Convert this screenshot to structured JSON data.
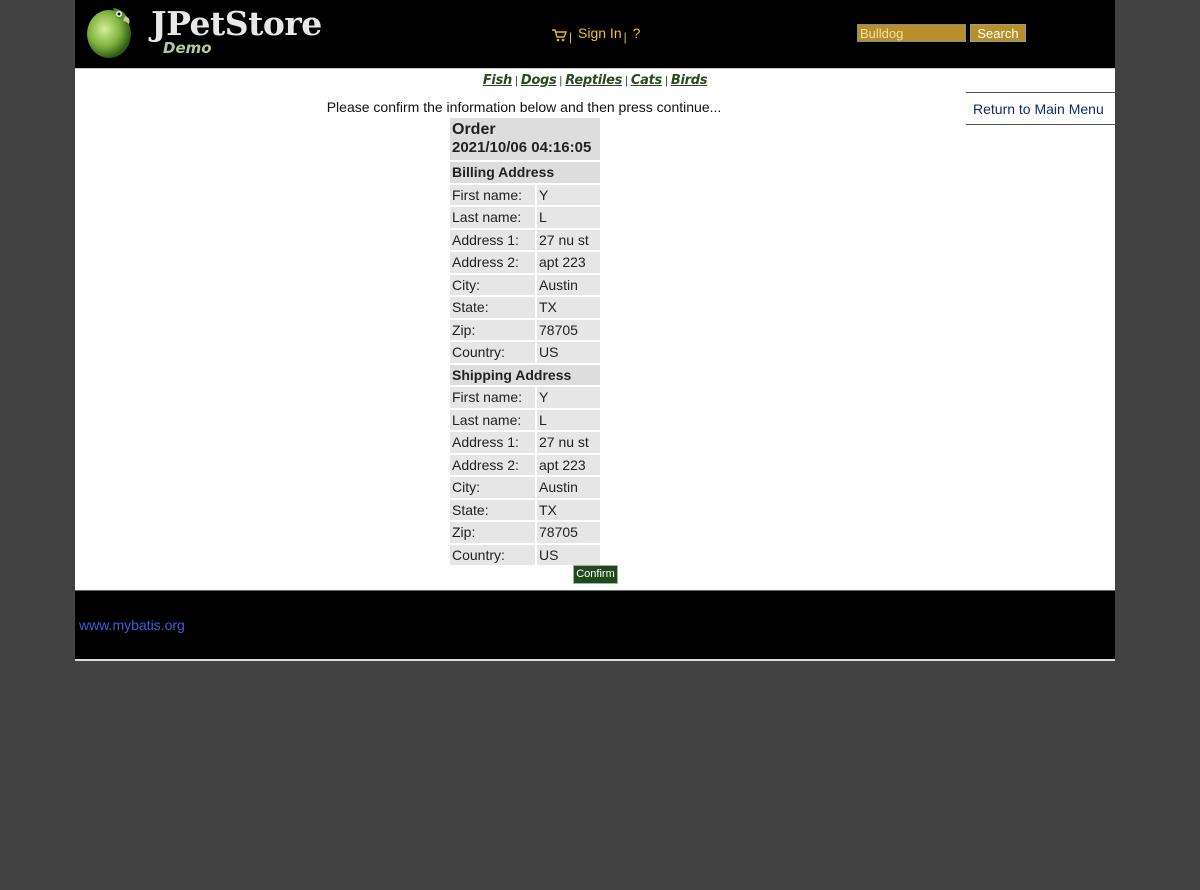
{
  "header": {
    "logo_text": "JPetStore",
    "logo_subtext": "Demo",
    "menu": {
      "sign_in": "Sign In",
      "help": "?"
    },
    "search": {
      "value": "Bulldog",
      "button": "Search"
    }
  },
  "quicklinks": [
    "Fish",
    "Dogs",
    "Reptiles",
    "Cats",
    "Birds"
  ],
  "return_link": "Return to Main Menu",
  "instructions": "Please confirm the information below and then press continue...",
  "order": {
    "title": "Order",
    "date": "2021/10/06 04:16:05",
    "billing": {
      "heading": "Billing Address",
      "rows": [
        {
          "label": "First name:",
          "value": "Y"
        },
        {
          "label": "Last name:",
          "value": "L"
        },
        {
          "label": "Address 1:",
          "value": "27 nu st"
        },
        {
          "label": "Address 2:",
          "value": "apt 223"
        },
        {
          "label": "City:",
          "value": "Austin"
        },
        {
          "label": "State:",
          "value": "TX"
        },
        {
          "label": "Zip:",
          "value": "78705"
        },
        {
          "label": "Country:",
          "value": "US"
        }
      ]
    },
    "shipping": {
      "heading": "Shipping Address",
      "rows": [
        {
          "label": "First name:",
          "value": "Y"
        },
        {
          "label": "Last name:",
          "value": "L"
        },
        {
          "label": "Address 1:",
          "value": "27 nu st"
        },
        {
          "label": "Address 2:",
          "value": "apt 223"
        },
        {
          "label": "City:",
          "value": "Austin"
        },
        {
          "label": "State:",
          "value": "TX"
        },
        {
          "label": "Zip:",
          "value": "78705"
        },
        {
          "label": "Country:",
          "value": "US"
        }
      ]
    }
  },
  "confirm_button": "Confirm",
  "footer": {
    "link": "www.mybatis.org"
  },
  "colors": {
    "header_bg": "#000000",
    "page_bg": "#424242",
    "link_gold": "#f2c32a",
    "quicklink_green": "#2b4a22"
  }
}
